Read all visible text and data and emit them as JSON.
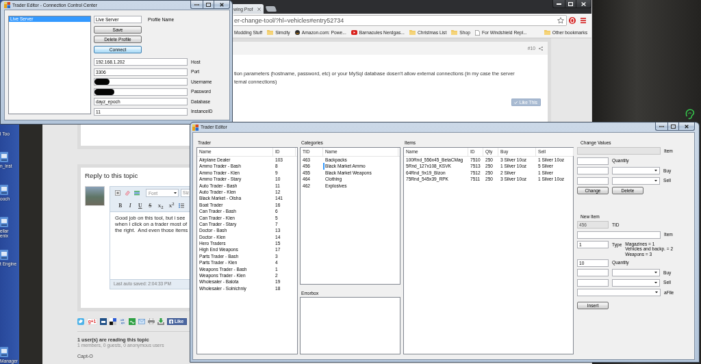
{
  "desktop": {
    "partial_label": "l Too",
    "icons": [
      {
        "label": "n_inst"
      },
      {
        "label": "ooch"
      },
      {
        "label": "ellar\nenix"
      },
      {
        "label": "t Engine"
      },
      {
        "label": "Manager"
      }
    ]
  },
  "browser": {
    "tab": {
      "title": "wing Prof"
    },
    "address": "er-change-tool/?hl=vehicles#entry52734",
    "bookmarks": [
      {
        "label": "Modding Stuff",
        "kind": "plain"
      },
      {
        "label": "Simcity",
        "kind": "folder"
      },
      {
        "label": "Amazon.com: Powe...",
        "kind": "site"
      },
      {
        "label": "Barnacules Nerdgas...",
        "kind": "video"
      },
      {
        "label": "Christmas List",
        "kind": "folder"
      },
      {
        "label": "Shop",
        "kind": "folder"
      },
      {
        "label": "For Windshield Repl...",
        "kind": "page"
      },
      {
        "label": "Other bookmarks",
        "kind": "folder"
      }
    ],
    "post": {
      "number": "#10",
      "lines": [
        "tion parameters (hostname, password, etc) or your MySql database dosen't allow external connections (in my case the server",
        "ternal connections)"
      ],
      "like": "Like This"
    },
    "reply": {
      "title": "Reply to this topic",
      "font_box": "Font",
      "size_box": "Siz",
      "format_buttons": [
        {
          "label": "B",
          "kind": "bold"
        },
        {
          "label": "I",
          "kind": "italic"
        },
        {
          "label": "U",
          "kind": "underline"
        },
        {
          "label": "S",
          "kind": "strike"
        },
        {
          "label": "X$_{2}$",
          "kind": "sub"
        },
        {
          "label": "X$^{2}$",
          "kind": "sup"
        }
      ],
      "text_lines": [
        "Good job on this tool, but i see",
        "when I click on a trader most of",
        "the right.  And even those items"
      ],
      "autosave": "Last auto saved: 2:04:33 PM"
    },
    "share": {
      "plus_one": "g+1",
      "like": "Like"
    },
    "readers": {
      "title": "1 user(s) are reading this topic",
      "summary": "1 members, 0 guests, 0 anonymous users",
      "users": [
        "Capt-O"
      ]
    }
  },
  "connection_window": {
    "title": "Trader Editor - Connection Control Center",
    "profiles": [
      {
        "label": "Live Server",
        "selected": true
      }
    ],
    "profile_name": {
      "value": "Live Server",
      "label": "Profile Name"
    },
    "buttons": [
      {
        "label": "Save",
        "focused": false
      },
      {
        "label": "Delete Profile",
        "focused": false
      },
      {
        "label": "Connect",
        "focused": true
      }
    ],
    "fields": [
      {
        "label": "Host",
        "value": "192.168.1.202",
        "redacted": false
      },
      {
        "label": "Port",
        "value": "3306",
        "redacted": false
      },
      {
        "label": "Username",
        "redacted": true
      },
      {
        "label": "Password",
        "redacted": true
      },
      {
        "label": "Database",
        "value": "dayz_epoch",
        "redacted": false
      },
      {
        "label": "InstanceID",
        "value": "11",
        "redacted": false
      }
    ]
  },
  "trader_window": {
    "title": "Trader Editor",
    "trader": {
      "label": "Trader",
      "columns": [
        "Name",
        "ID"
      ],
      "rows": [
        {
          "cells": [
            "Airplane Dealer",
            "103"
          ],
          "selected": false
        },
        {
          "cells": [
            "Ammo Trader - Bash",
            "8"
          ],
          "selected": false
        },
        {
          "cells": [
            "Ammo Trader - Klen",
            "9"
          ],
          "selected": false
        },
        {
          "cells": [
            "Ammo Trader - Stary",
            "10"
          ],
          "selected": false
        },
        {
          "cells": [
            "Auto Trader - Bash",
            "11"
          ],
          "selected": false
        },
        {
          "cells": [
            "Auto Trader - Klen",
            "12"
          ],
          "selected": false
        },
        {
          "cells": [
            "Black Market - Olsha",
            "141"
          ],
          "selected": false
        },
        {
          "cells": [
            "Boat Trader",
            "16"
          ],
          "selected": false
        },
        {
          "cells": [
            "Can Trader - Bash",
            "6"
          ],
          "selected": false
        },
        {
          "cells": [
            "Can Trader - Klen",
            "5"
          ],
          "selected": false
        },
        {
          "cells": [
            "Can Trader - Stary",
            "7"
          ],
          "selected": false
        },
        {
          "cells": [
            "Doctor - Bash",
            "13"
          ],
          "selected": false
        },
        {
          "cells": [
            "Doctor - Klen",
            "14"
          ],
          "selected": false
        },
        {
          "cells": [
            "Hero Traders",
            "15"
          ],
          "selected": false
        },
        {
          "cells": [
            "High End Weapons",
            "17"
          ],
          "selected": false
        },
        {
          "cells": [
            "Parts Trader - Bash",
            "3"
          ],
          "selected": false
        },
        {
          "cells": [
            "Parts Trader - Klen",
            "4"
          ],
          "selected": false
        },
        {
          "cells": [
            "Weapons Trader - Bash",
            "1"
          ],
          "selected": false
        },
        {
          "cells": [
            "Weapons Trader - Klen",
            "2"
          ],
          "selected": false
        },
        {
          "cells": [
            "Wholesaler - Balota",
            "19"
          ],
          "selected": false
        },
        {
          "cells": [
            "Wholesaler - Solnichniy",
            "18"
          ],
          "selected": false
        }
      ]
    },
    "categories": {
      "label": "Categories",
      "columns": [
        "TID",
        "Name"
      ],
      "rows": [
        {
          "cells": [
            "463",
            "Backpacks"
          ],
          "selected": false
        },
        {
          "cells": [
            "456",
            "Black Market Ammo"
          ],
          "selected": true
        },
        {
          "cells": [
            "455",
            "Black Market Weapons"
          ],
          "selected": false
        },
        {
          "cells": [
            "464",
            "Clothing"
          ],
          "selected": false
        },
        {
          "cells": [
            "462",
            "Explosives"
          ],
          "selected": false
        }
      ]
    },
    "errorbox": {
      "label": "Errorbox"
    },
    "items": {
      "label": "Items",
      "columns": [
        "Name",
        "ID",
        "Qty",
        "Buy",
        "Sell"
      ],
      "rows": [
        {
          "cells": [
            "100Rnd_556x45_BetaCMag",
            "7510",
            "250",
            "3 Silver 10oz",
            "1 Silver 10oz"
          ],
          "selected": false
        },
        {
          "cells": [
            "5Rnd_127x108_KSVK",
            "7513",
            "250",
            "1 Silver 10oz",
            "5 Silver"
          ],
          "selected": false
        },
        {
          "cells": [
            "64Rnd_9x19_Bizon",
            "7512",
            "250",
            "2 Silver",
            "1 Silver"
          ],
          "selected": false
        },
        {
          "cells": [
            "75Rnd_545x39_RPK",
            "7511",
            "250",
            "3 Silver 10oz",
            "1 Silver 10oz"
          ],
          "selected": false
        }
      ]
    },
    "change_values": {
      "label": "Change Values",
      "rows": [
        {
          "kind": "wide",
          "label": "Item",
          "disabled": true
        },
        {
          "kind": "field",
          "label": "Quantity",
          "disabled": false
        },
        {
          "kind": "combo",
          "label": "Buy",
          "disabled": false
        },
        {
          "kind": "combo",
          "label": "Sell",
          "disabled": false
        }
      ],
      "buttons": [
        "Change",
        "Delete"
      ]
    },
    "new_item": {
      "label": "New Item",
      "rows": [
        {
          "kind": "field",
          "label": "TID",
          "value": "456",
          "disabled": true
        },
        {
          "kind": "wide",
          "label": "Item",
          "disabled": false
        },
        {
          "kind": "field",
          "label": "Type",
          "value": "1",
          "disabled": false,
          "hint": [
            "Magazines = 1",
            "Vehicles and backp. = 2",
            "Weapons = 3"
          ]
        },
        {
          "kind": "field",
          "label": "Quantity",
          "value": "10",
          "disabled": false
        },
        {
          "kind": "combo",
          "label": "Buy",
          "disabled": false
        },
        {
          "kind": "combo",
          "label": "Sell",
          "disabled": false
        },
        {
          "kind": "dropdown",
          "label": "aFile",
          "disabled": false
        }
      ],
      "buttons": [
        "Insert"
      ]
    }
  }
}
